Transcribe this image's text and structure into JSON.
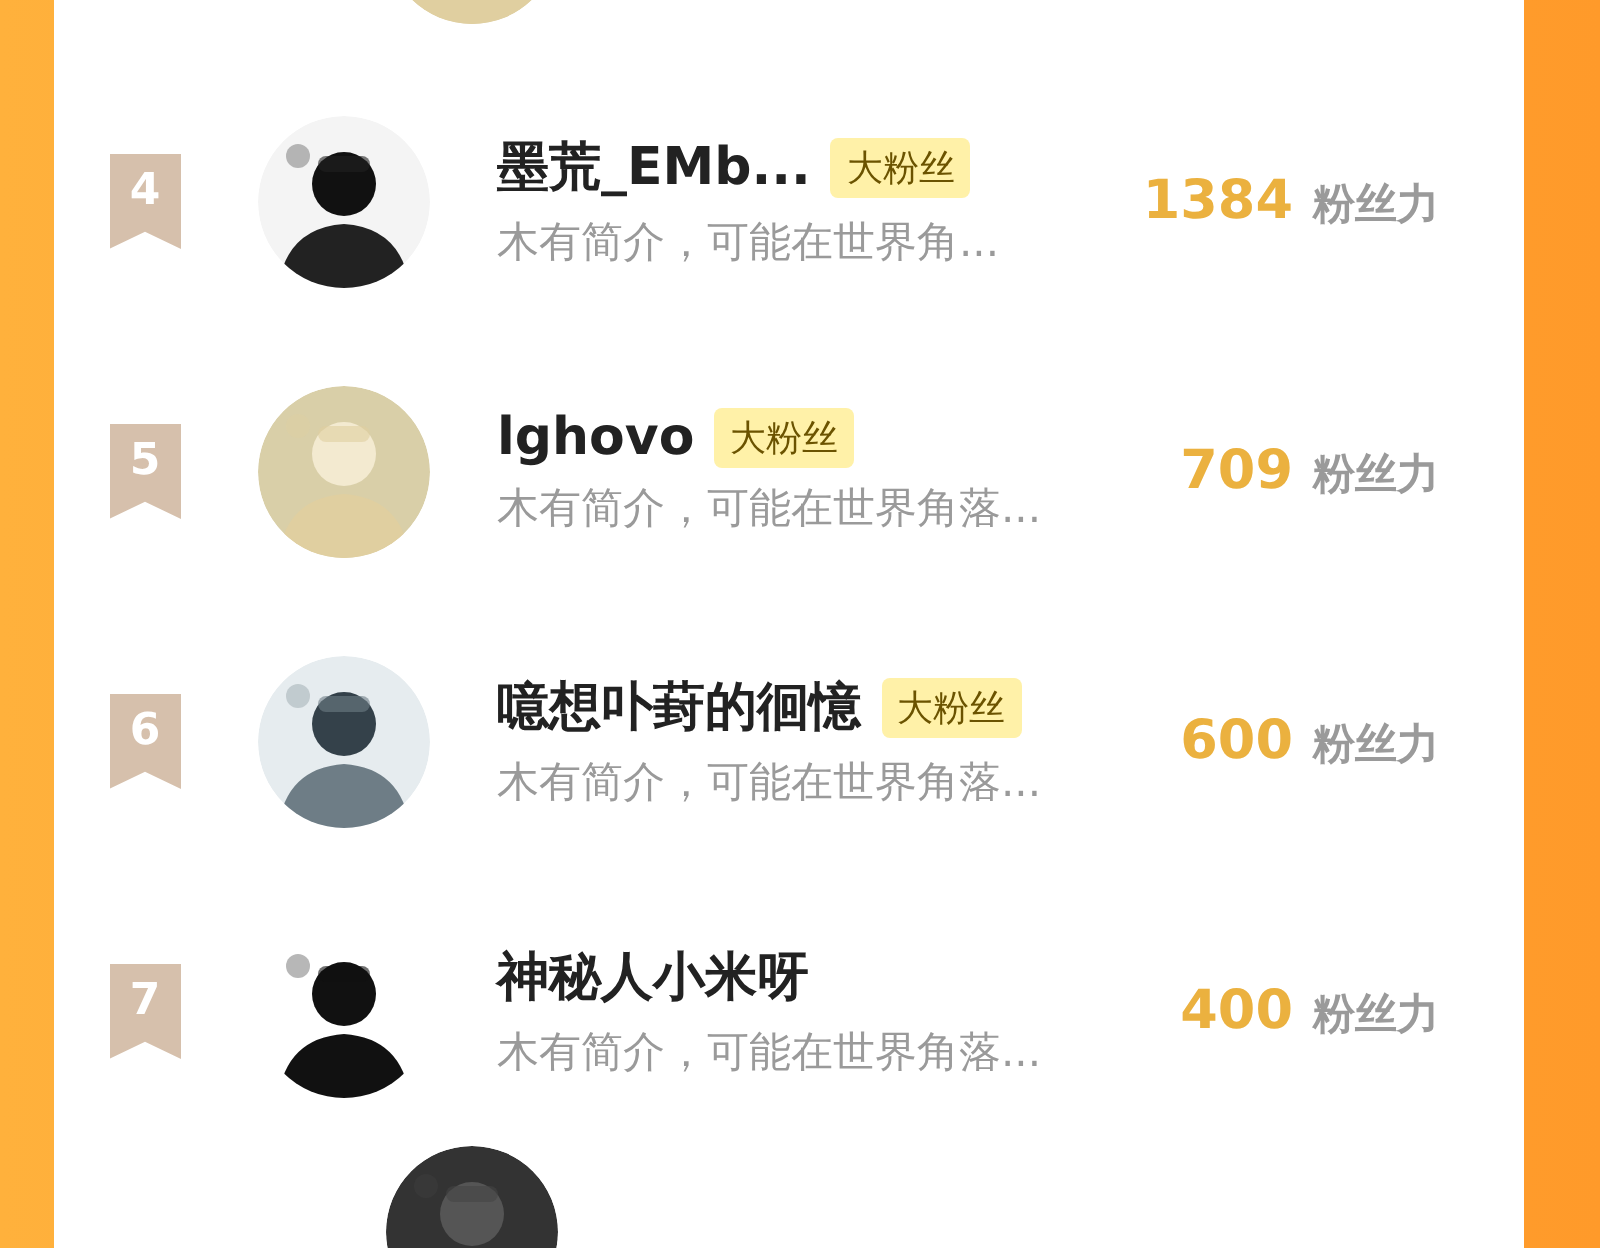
{
  "fans": [
    {
      "rank": "4",
      "name": "墨荒_EMb...",
      "badge": "大粉丝",
      "bio": "木有简介，可能在世界角...",
      "count": "1384",
      "unit": "粉丝力"
    },
    {
      "rank": "5",
      "name": "lghovo",
      "badge": "大粉丝",
      "bio": "木有简介，可能在世界角落...",
      "count": "709",
      "unit": "粉丝力"
    },
    {
      "rank": "6",
      "name": "噫想卟葑的徊憶",
      "badge": "大粉丝",
      "bio": "木有简介，可能在世界角落...",
      "count": "600",
      "unit": "粉丝力"
    },
    {
      "rank": "7",
      "name": "神秘人小米呀",
      "bio": "木有简介，可能在世界角落...",
      "count": "400",
      "unit": "粉丝力"
    }
  ]
}
